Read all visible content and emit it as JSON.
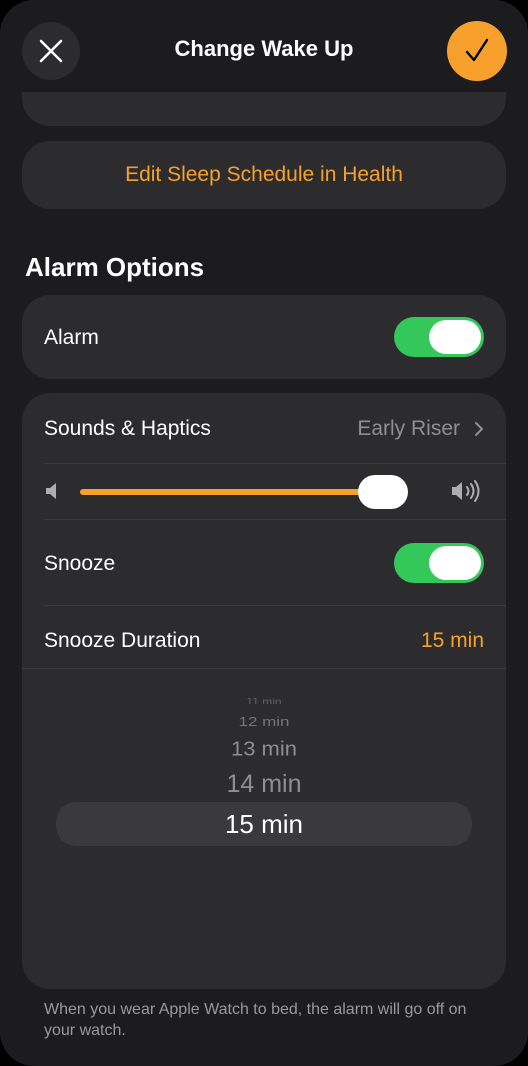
{
  "header": {
    "title": "Change Wake Up",
    "close_icon": "close-icon",
    "done_icon": "checkmark-icon",
    "accent": "#f7a12c"
  },
  "edit_schedule_link": "Edit Sleep Schedule in Health",
  "alarm_options": {
    "section_title": "Alarm Options",
    "alarm": {
      "label": "Alarm",
      "on": true
    },
    "sounds": {
      "label": "Sounds & Haptics",
      "value": "Early Riser"
    },
    "volume": {
      "level": 0.92
    },
    "snooze": {
      "label": "Snooze",
      "on": true
    },
    "snooze_duration": {
      "label": "Snooze Duration",
      "value": "15 min"
    }
  },
  "picker": {
    "items": [
      "11 min",
      "12 min",
      "13 min",
      "14 min",
      "15 min"
    ],
    "selected": "15 min"
  },
  "footer_note": "When you wear Apple Watch to bed, the alarm will go off on your watch."
}
